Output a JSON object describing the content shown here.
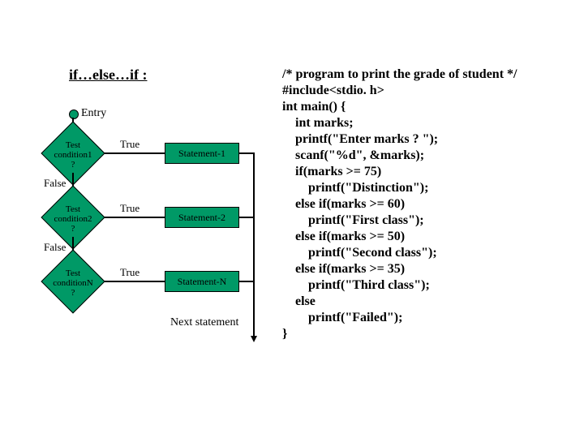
{
  "title": "if…else…if :",
  "entry": "Entry",
  "diamonds": [
    {
      "label": "Test\ncondition1\n?"
    },
    {
      "label": "Test\ncondition2\n?"
    },
    {
      "label": "Test\nconditionN\n?"
    }
  ],
  "branches": {
    "true": "True",
    "false": "False"
  },
  "stmts": [
    "Statement-1",
    "Statement-2",
    "Statement-N"
  ],
  "next_statement": "Next statement",
  "code": "/* program to print the grade of student */\n#include<stdio. h>\nint main() {\n    int marks;\n    printf(\"Enter marks ? \");\n    scanf(\"%d\", &marks);\n    if(marks >= 75)\n        printf(\"Distinction\");\n    else if(marks >= 60)\n        printf(\"First class\");\n    else if(marks >= 50)\n        printf(\"Second class\");\n    else if(marks >= 35)\n        printf(\"Third class\");\n    else\n        printf(\"Failed\");\n}"
}
